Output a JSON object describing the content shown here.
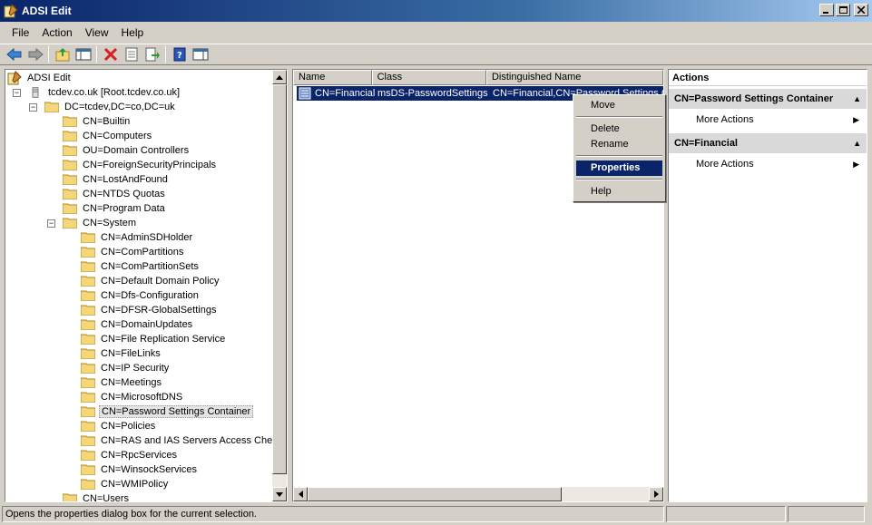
{
  "window": {
    "title": "ADSI Edit"
  },
  "menu": [
    "File",
    "Action",
    "View",
    "Help"
  ],
  "tree": {
    "root": "ADSI Edit",
    "items": [
      {
        "label": "tcdev.co.uk [Root.tcdev.co.uk]",
        "level": 1,
        "expanded": true,
        "icon": "server-icon"
      },
      {
        "label": "DC=tcdev,DC=co,DC=uk",
        "level": 2,
        "expanded": true
      },
      {
        "label": "CN=Builtin",
        "level": 3
      },
      {
        "label": "CN=Computers",
        "level": 3
      },
      {
        "label": "OU=Domain Controllers",
        "level": 3
      },
      {
        "label": "CN=ForeignSecurityPrincipals",
        "level": 3
      },
      {
        "label": "CN=LostAndFound",
        "level": 3
      },
      {
        "label": "CN=NTDS Quotas",
        "level": 3
      },
      {
        "label": "CN=Program Data",
        "level": 3
      },
      {
        "label": "CN=System",
        "level": 3,
        "expanded": true
      },
      {
        "label": "CN=AdminSDHolder",
        "level": 4
      },
      {
        "label": "CN=ComPartitions",
        "level": 4
      },
      {
        "label": "CN=ComPartitionSets",
        "level": 4
      },
      {
        "label": "CN=Default Domain Policy",
        "level": 4
      },
      {
        "label": "CN=Dfs-Configuration",
        "level": 4
      },
      {
        "label": "CN=DFSR-GlobalSettings",
        "level": 4
      },
      {
        "label": "CN=DomainUpdates",
        "level": 4
      },
      {
        "label": "CN=File Replication Service",
        "level": 4
      },
      {
        "label": "CN=FileLinks",
        "level": 4
      },
      {
        "label": "CN=IP Security",
        "level": 4
      },
      {
        "label": "CN=Meetings",
        "level": 4
      },
      {
        "label": "CN=MicrosoftDNS",
        "level": 4
      },
      {
        "label": "CN=Password Settings Container",
        "level": 4,
        "selected": true
      },
      {
        "label": "CN=Policies",
        "level": 4
      },
      {
        "label": "CN=RAS and IAS Servers Access Check",
        "level": 4
      },
      {
        "label": "CN=RpcServices",
        "level": 4
      },
      {
        "label": "CN=WinsockServices",
        "level": 4
      },
      {
        "label": "CN=WMIPolicy",
        "level": 4
      },
      {
        "label": "CN=Users",
        "level": 3
      }
    ]
  },
  "list": {
    "columns": [
      "Name",
      "Class",
      "Distinguished Name"
    ],
    "rows": [
      {
        "name": "CN=Financial",
        "class": "msDS-PasswordSettings",
        "dn": "CN=Financial,CN=Password Settings C"
      }
    ]
  },
  "context_menu": {
    "move": "Move",
    "delete": "Delete",
    "rename": "Rename",
    "properties": "Properties",
    "help": "Help"
  },
  "actions": {
    "title": "Actions",
    "groups": [
      {
        "label": "CN=Password Settings Container",
        "item": "More Actions"
      },
      {
        "label": "CN=Financial",
        "item": "More Actions"
      }
    ]
  },
  "status": {
    "text": "Opens the properties dialog box for the current selection."
  },
  "colors": {
    "title_start": "#0a246a",
    "selection": "#0a246a",
    "folder": "#f5d77b"
  }
}
